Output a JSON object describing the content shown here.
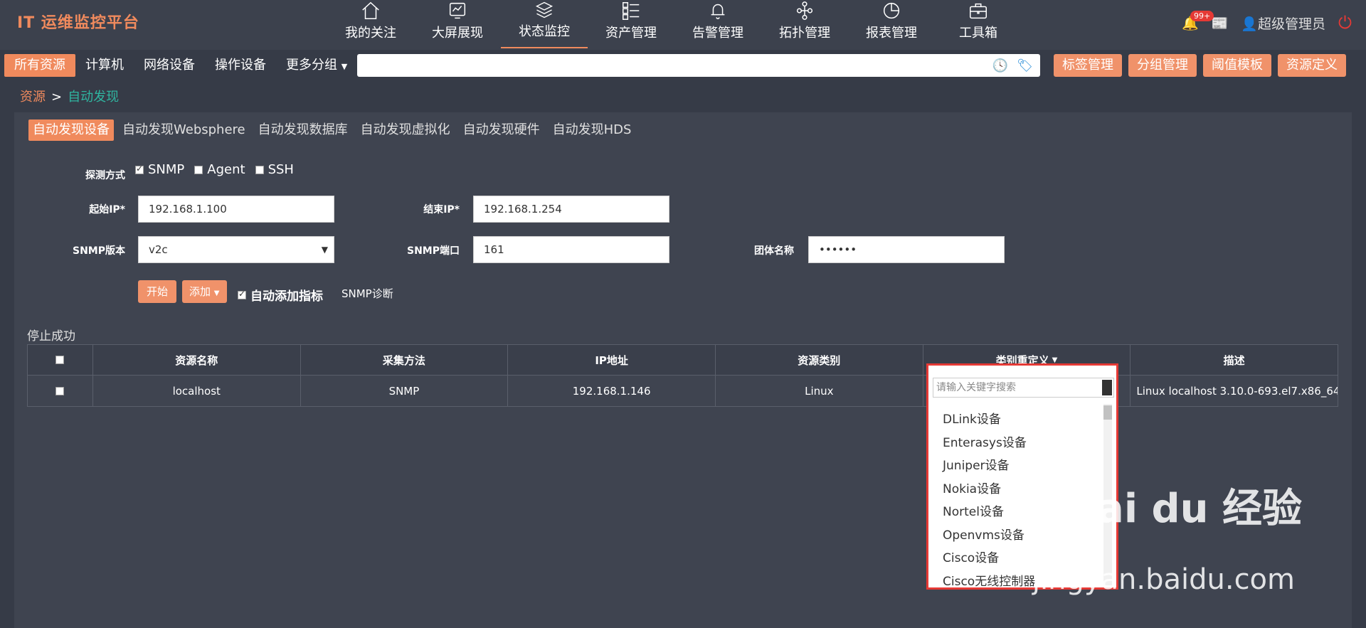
{
  "app": {
    "title": "IT 运维监控平台"
  },
  "nav": [
    {
      "label": "我的关注",
      "icon": "home-icon"
    },
    {
      "label": "大屏展现",
      "icon": "monitor-icon"
    },
    {
      "label": "状态监控",
      "icon": "layers-icon"
    },
    {
      "label": "资产管理",
      "icon": "list-icon"
    },
    {
      "label": "告警管理",
      "icon": "bell-icon"
    },
    {
      "label": "拓扑管理",
      "icon": "topology-icon"
    },
    {
      "label": "报表管理",
      "icon": "pie-chart-icon"
    },
    {
      "label": "工具箱",
      "icon": "toolbox-icon"
    }
  ],
  "header_right": {
    "badge": "99+",
    "user": "超级管理员"
  },
  "groups": [
    "所有资源",
    "计算机",
    "网络设备",
    "操作设备",
    "更多分组"
  ],
  "actions": [
    "标签管理",
    "分组管理",
    "阈值模板",
    "资源定义"
  ],
  "breadcrumb": {
    "root": "资源",
    "sep": ">",
    "current": "自动发现"
  },
  "tabs": [
    "自动发现设备",
    "自动发现Websphere",
    "自动发现数据库",
    "自动发现虚拟化",
    "自动发现硬件",
    "自动发现HDS"
  ],
  "form": {
    "probe_label": "探测方式",
    "probe_options": [
      "SNMP",
      "Agent",
      "SSH"
    ],
    "start_ip_label": "起始IP*",
    "start_ip": "192.168.1.100",
    "end_ip_label": "结束IP*",
    "end_ip": "192.168.1.254",
    "snmp_version_label": "SNMP版本",
    "snmp_version": "v2c",
    "snmp_port_label": "SNMP端口",
    "snmp_port": "161",
    "community_label": "团体名称",
    "community": "••••••",
    "start_btn": "开始",
    "add_btn": "添加",
    "auto_add": "自动添加指标",
    "snmp_diag": "SNMP诊断"
  },
  "status": "停止成功",
  "table": {
    "headers": [
      "资源名称",
      "采集方法",
      "IP地址",
      "资源类别",
      "类别重定义",
      "描述"
    ],
    "rows": [
      {
        "name": "localhost",
        "method": "SNMP",
        "ip": "192.168.1.146",
        "type": "Linux",
        "desc": "Linux localhost 3.10.0-693.el7.x86_64 ..."
      }
    ]
  },
  "dropdown": {
    "placeholder": "请输入关键字搜索",
    "items": [
      "DLink设备",
      "Enterasys设备",
      "Juniper设备",
      "Nokia设备",
      "Nortel设备",
      "Openvms设备",
      "Cisco设备",
      "Cisco无线控制器"
    ]
  },
  "watermark": {
    "brand": "Bai du 经验",
    "url": "jingyan.baidu.com"
  }
}
